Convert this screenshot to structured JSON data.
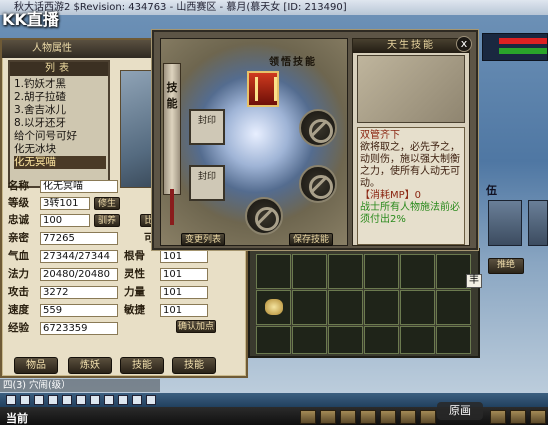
{
  "window": {
    "title": "秋大话西游2 $Revision: 434763 - 山西赛区 - 慕月(慕天女 [ID: 213490]"
  },
  "watermark": "KK直播",
  "left_panel": {
    "header": "人物属性",
    "list_title": "列表",
    "list_items": [
      "1.钓妖才黑",
      "2.胡子拉碴",
      "3.舍吉冰儿",
      "8.以牙还牙",
      "给个问号可好",
      "化无冰块",
      "化无冥喵"
    ],
    "selected_index": 6
  },
  "stats": {
    "name_label": "名称",
    "name_value": "化无冥喵",
    "level_label": "等级",
    "level_value": "3转101",
    "level_btn": "修生",
    "loyalty_label": "忠诚",
    "loyalty_value": "100",
    "loyalty_btn": "驯养",
    "friend_btn": "比",
    "exp_label": "亲密",
    "exp_value": "77265",
    "hp_label": "气血",
    "hp_value": "27344/27344",
    "mp_label": "法力",
    "mp_value": "20480/20480",
    "atk_label": "攻击",
    "atk_value": "3272",
    "spd_label": "速度",
    "spd_value": "559",
    "xp_label": "经验",
    "xp_value": "6723359",
    "side_can": "可分",
    "gen_label": "根骨",
    "gen_value": "101",
    "ling_label": "灵性",
    "ling_value": "101",
    "li_label": "力量",
    "li_value": "101",
    "min_label": "敏捷",
    "min_value": "101",
    "confirm_btn": "确认加点"
  },
  "bottom_buttons": [
    "物品",
    "炼妖",
    "技能",
    "技能"
  ],
  "skill_window": {
    "scroll_label": "技能",
    "title": "领悟技能",
    "lock_label": "封印",
    "btn_left": "变更列表",
    "btn_right": "保存技能",
    "close": "x"
  },
  "talent": {
    "header": "天生技能",
    "skill_name": "双管齐下",
    "desc": "欲将取之，必先予之，动则伤，施以强大制衡之力，使所有人动无可动。",
    "cost": "【消耗MP】0",
    "extra": "战士所有人物施法前必须付出2%"
  },
  "right": {
    "team_title": "伍",
    "btn_label": "推绝",
    "fan_label": "丰"
  },
  "bottom": {
    "chat": "四(3)  穴闹(级）",
    "current": "当前",
    "orig_btn": "原画"
  }
}
